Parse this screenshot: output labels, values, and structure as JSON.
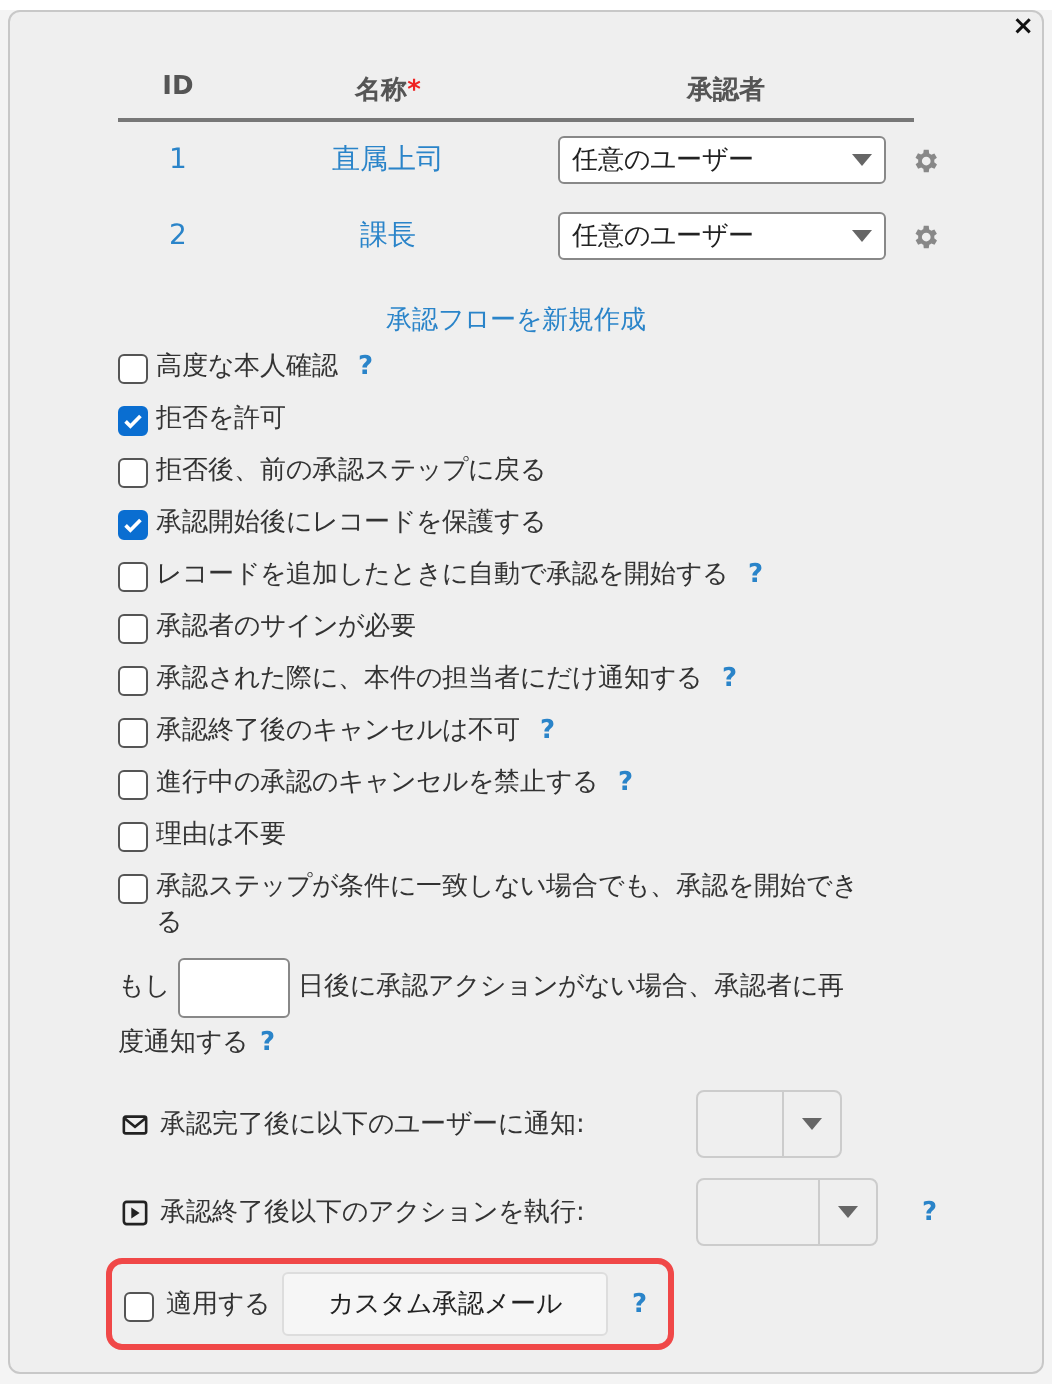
{
  "dialog": {
    "close": "×"
  },
  "steps": {
    "columns": [
      {
        "label": "ID"
      },
      {
        "label": "名称",
        "mark": "*"
      },
      {
        "label": "承認者"
      }
    ],
    "rows": [
      {
        "id": "1",
        "name": "直属上司",
        "approver": "任意のユーザー"
      },
      {
        "id": "2",
        "name": "課長",
        "approver": "任意のユーザー"
      }
    ]
  },
  "create_flow_link": "承認フローを新規作成",
  "options": [
    {
      "label": "高度な本人確認",
      "checked": false,
      "help": "?"
    },
    {
      "label": "拒否を許可",
      "checked": true
    },
    {
      "label": "拒否後、前の承認ステップに戻る",
      "checked": false
    },
    {
      "label": "承認開始後にレコードを保護する",
      "checked": true
    },
    {
      "label": "レコードを追加したときに自動で承認を開始する",
      "checked": false,
      "help": "?"
    },
    {
      "label": "承認者のサインが必要",
      "checked": false
    },
    {
      "label": "承認された際に、本件の担当者にだけ通知する",
      "checked": false,
      "help": "?"
    },
    {
      "label": "承認終了後のキャンセルは不可",
      "checked": false,
      "help": "?"
    },
    {
      "label": "進行中の承認のキャンセルを禁止する",
      "checked": false,
      "help": "?"
    },
    {
      "label": "理由は不要",
      "checked": false
    },
    {
      "label": "承認ステップが条件に一致しない場合でも、承認を開始できる",
      "checked": false
    }
  ],
  "reminder": {
    "before": "もし",
    "after": "日後に承認アクションがない場合、承認者に再",
    "after_continued": "度通知する",
    "help": "?"
  },
  "notify_on_complete": {
    "label": "承認完了後に以下のユーザーに通知:"
  },
  "action_on_end": {
    "label": "承認終了後以下のアクションを執行:",
    "help": "?"
  },
  "custom_mail": {
    "apply_label": "適用する",
    "checked": false,
    "button": "カスタム承認メール",
    "help": "?"
  }
}
